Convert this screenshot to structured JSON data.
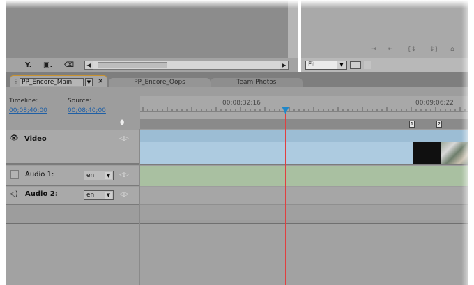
{
  "project_toolbar": {
    "icons": [
      "funnel-icon",
      "new-bin-icon",
      "trash-icon"
    ]
  },
  "source_monitor": {
    "zoom_value": "Fit",
    "trim_icons": [
      "ripple-in-icon",
      "ripple-out-icon",
      "mark-in-icon",
      "mark-out-icon",
      "set-marker-icon"
    ]
  },
  "tabs": [
    {
      "label": "PP_Encore_Main",
      "active": true
    },
    {
      "label": "PP_Encore_Oops",
      "active": false
    },
    {
      "label": "Team Photos",
      "active": false
    }
  ],
  "timeline": {
    "timeline_label": "Timeline:",
    "timeline_timecode": "00;08;40;00",
    "source_label": "Source:",
    "source_timecode": "00;08;40;00",
    "ruler_times": [
      "00;08;32;16",
      "00;09;06;22"
    ],
    "markers": [
      "1",
      "2"
    ]
  },
  "tracks": {
    "video": {
      "label": "Video"
    },
    "audio1": {
      "label": "Audio 1:",
      "language": "en"
    },
    "audio2": {
      "label": "Audio 2:",
      "language": "en"
    }
  },
  "colors": {
    "accent": "#c8922f",
    "timecode": "#1f5fa5",
    "video_track": "#adcbe0",
    "audio_track": "#a9c0a1",
    "playhead": "#e04040"
  }
}
